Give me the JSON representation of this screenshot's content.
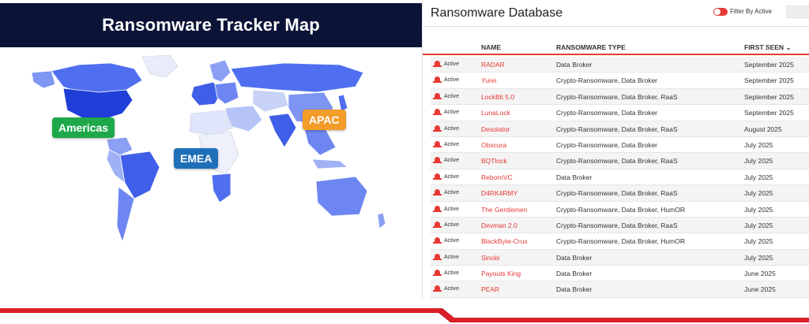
{
  "map": {
    "title": "Ransomware Tracker Map",
    "regions": {
      "americas": "Americas",
      "emea": "EMEA",
      "apac": "APAC"
    }
  },
  "database": {
    "title": "Ransomware Database",
    "filter_label": "Filter By Active",
    "columns": {
      "name": "NAME",
      "type": "RANSOMWARE TYPE",
      "first_seen": "FIRST SEEN ⌄"
    },
    "status_label": "Active",
    "rows": [
      {
        "name": "RADAR",
        "type": "Data Broker",
        "first_seen": "September 2025"
      },
      {
        "name": "Yurei",
        "type": "Crypto-Ransomware, Data Broker",
        "first_seen": "September 2025"
      },
      {
        "name": "LockBit 5.0",
        "type": "Crypto-Ransomware, Data Broker, RaaS",
        "first_seen": "September 2025"
      },
      {
        "name": "LunaLock",
        "type": "Crypto-Ransomware, Data Broker",
        "first_seen": "September 2025"
      },
      {
        "name": "Desolator",
        "type": "Crypto-Ransomware, Data Broker, RaaS",
        "first_seen": "August 2025"
      },
      {
        "name": "Obscura",
        "type": "Crypto-Ransomware, Data Broker",
        "first_seen": "July 2025"
      },
      {
        "name": "BQTlock",
        "type": "Crypto-Ransomware, Data Broker, RaaS",
        "first_seen": "July 2025"
      },
      {
        "name": "RebornVC",
        "type": "Data Broker",
        "first_seen": "July 2025"
      },
      {
        "name": "D4RK4RMY",
        "type": "Crypto-Ransomware, Data Broker, RaaS",
        "first_seen": "July 2025"
      },
      {
        "name": "The Gentlemen",
        "type": "Crypto-Ransomware, Data Broker, HumOR",
        "first_seen": "July 2025"
      },
      {
        "name": "Devman 2.0",
        "type": "Crypto-Ransomware, Data Broker, RaaS",
        "first_seen": "July 2025"
      },
      {
        "name": "BlackByte-Crux",
        "type": "Crypto-Ransomware, Data Broker, HumOR",
        "first_seen": "July 2025"
      },
      {
        "name": "Sinobi",
        "type": "Data Broker",
        "first_seen": "July 2025"
      },
      {
        "name": "Payouts King",
        "type": "Data Broker",
        "first_seen": "June 2025"
      },
      {
        "name": "PEAR",
        "type": "Data Broker",
        "first_seen": "June 2025"
      }
    ]
  },
  "colors": {
    "title_bar": "#0b1437",
    "accent_red": "#e53935",
    "americas": "#1ea84a",
    "emea": "#1f6fb8",
    "apac": "#f39c2a",
    "map_dark": "#1f3fd8",
    "map_light": "#c9d3f7"
  },
  "icons": {
    "status": "siren-icon",
    "sort": "chevron-down-icon"
  }
}
